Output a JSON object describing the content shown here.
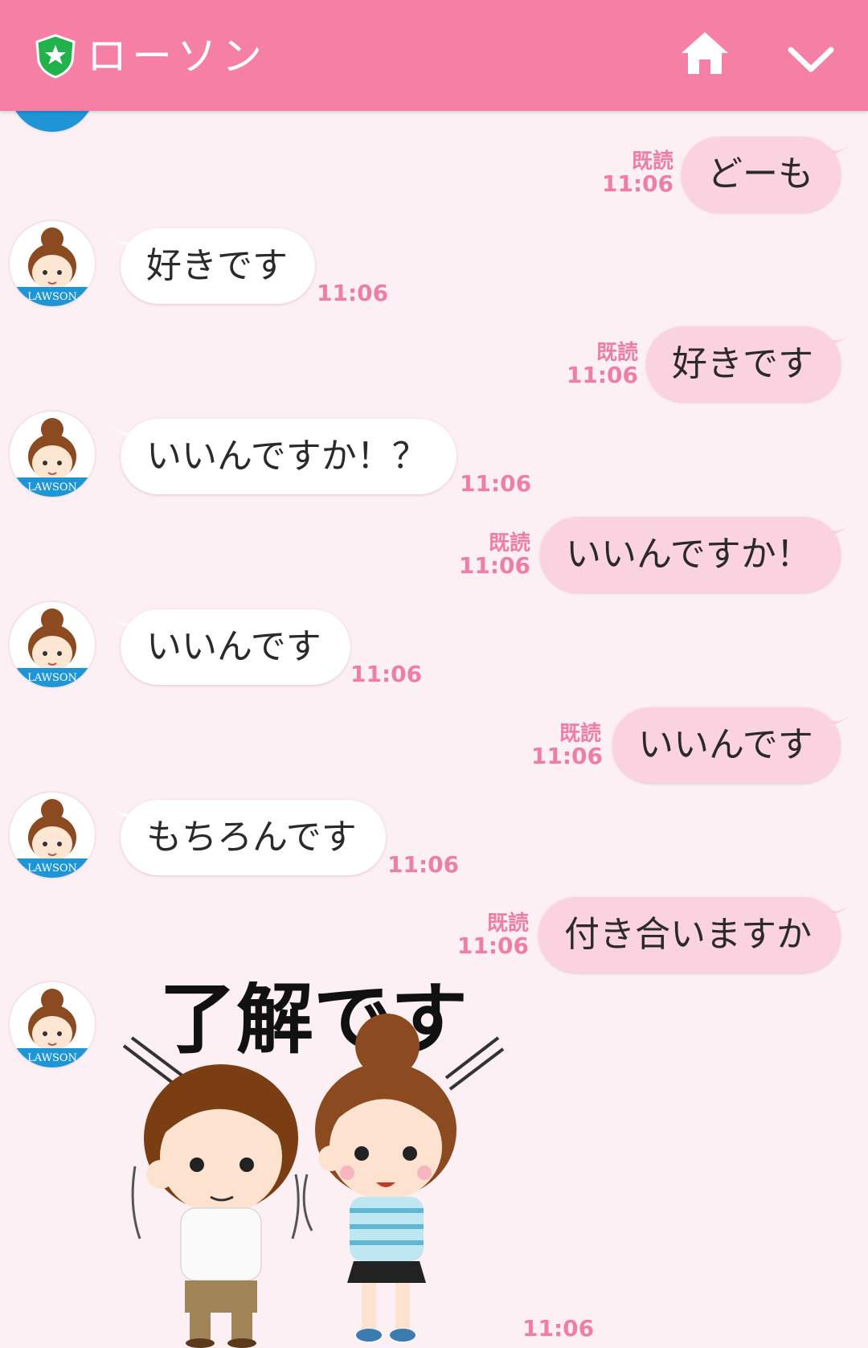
{
  "header": {
    "title": "ローソン",
    "shield_icon": "shield-star-icon",
    "home_icon": "home-icon",
    "menu_icon": "chevron-down-icon",
    "bg_color": "#f57fa5"
  },
  "avatar": {
    "label": "LAWSON"
  },
  "messages": [
    {
      "dir": "out",
      "text": "どーも",
      "read": "既読",
      "time": "11:06"
    },
    {
      "dir": "in",
      "text": "好きです",
      "time": "11:06"
    },
    {
      "dir": "out",
      "text": "好きです",
      "read": "既読",
      "time": "11:06"
    },
    {
      "dir": "in",
      "text": "いいんですか！？",
      "time": "11:06"
    },
    {
      "dir": "out",
      "text": "いいんですか！",
      "read": "既読",
      "time": "11:06"
    },
    {
      "dir": "in",
      "text": "いいんです",
      "time": "11:06"
    },
    {
      "dir": "out",
      "text": "いいんです",
      "read": "既読",
      "time": "11:06"
    },
    {
      "dir": "in",
      "text": "もちろんです",
      "time": "11:06"
    },
    {
      "dir": "out",
      "text": "付き合いますか",
      "read": "既読",
      "time": "11:06"
    },
    {
      "dir": "in",
      "sticker": "sticker-ryoukai",
      "sticker_text": "了解です",
      "time": "11:06"
    }
  ]
}
